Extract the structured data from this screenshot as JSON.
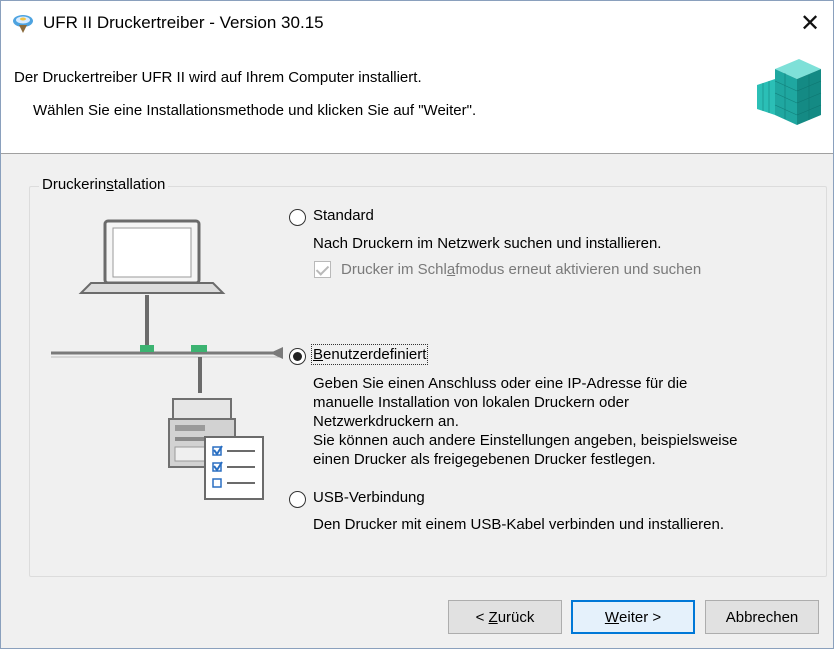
{
  "window": {
    "title": "UFR II Druckertreiber - Version 30.15",
    "close_glyph": "✕"
  },
  "header": {
    "line1": "Der Druckertreiber UFR II wird auf Ihrem Computer installiert.",
    "line2": "Wählen Sie eine Installationsmethode und klicken Sie auf \"Weiter\"."
  },
  "group": {
    "label_before": "Druckerin",
    "label_mnemonic": "s",
    "label_after": "tallation"
  },
  "options": {
    "standard": {
      "label": "Standard",
      "checked": false,
      "description": "Nach Druckern im Netzwerk suchen und installieren.",
      "sleep_checkbox_before": "Drucker im Schl",
      "sleep_checkbox_mnemonic": "a",
      "sleep_checkbox_after": "fmodus erneut aktivieren und suchen",
      "sleep_checkbox_checked": true,
      "sleep_checkbox_enabled": false
    },
    "custom": {
      "label_mnemonic": "B",
      "label_rest": "enutzerdefiniert",
      "checked": true,
      "description_lines": [
        "Geben Sie einen Anschluss oder eine IP-Adresse für die",
        "manuelle Installation von lokalen Druckern oder",
        "Netzwerkdruckern an.",
        "Sie können auch andere Einstellungen angeben, beispielsweise",
        "einen Drucker als freigegebenen Drucker festlegen."
      ]
    },
    "usb": {
      "label": "USB-Verbindung",
      "checked": false,
      "description": "Den Drucker mit einem USB-Kabel verbinden und installieren."
    }
  },
  "buttons": {
    "back_prefix": "< ",
    "back_mnemonic": "Z",
    "back_rest": "urück",
    "next_mnemonic": "W",
    "next_rest": "eiter >",
    "cancel": "Abbrechen"
  },
  "icons": {
    "title": "printer-driver-icon",
    "header_logo": "canon-cube-logo-icon"
  },
  "colors": {
    "accent": "#0078d7",
    "network_connector": "#3cb371",
    "logo_cube": "#20b2aa"
  }
}
